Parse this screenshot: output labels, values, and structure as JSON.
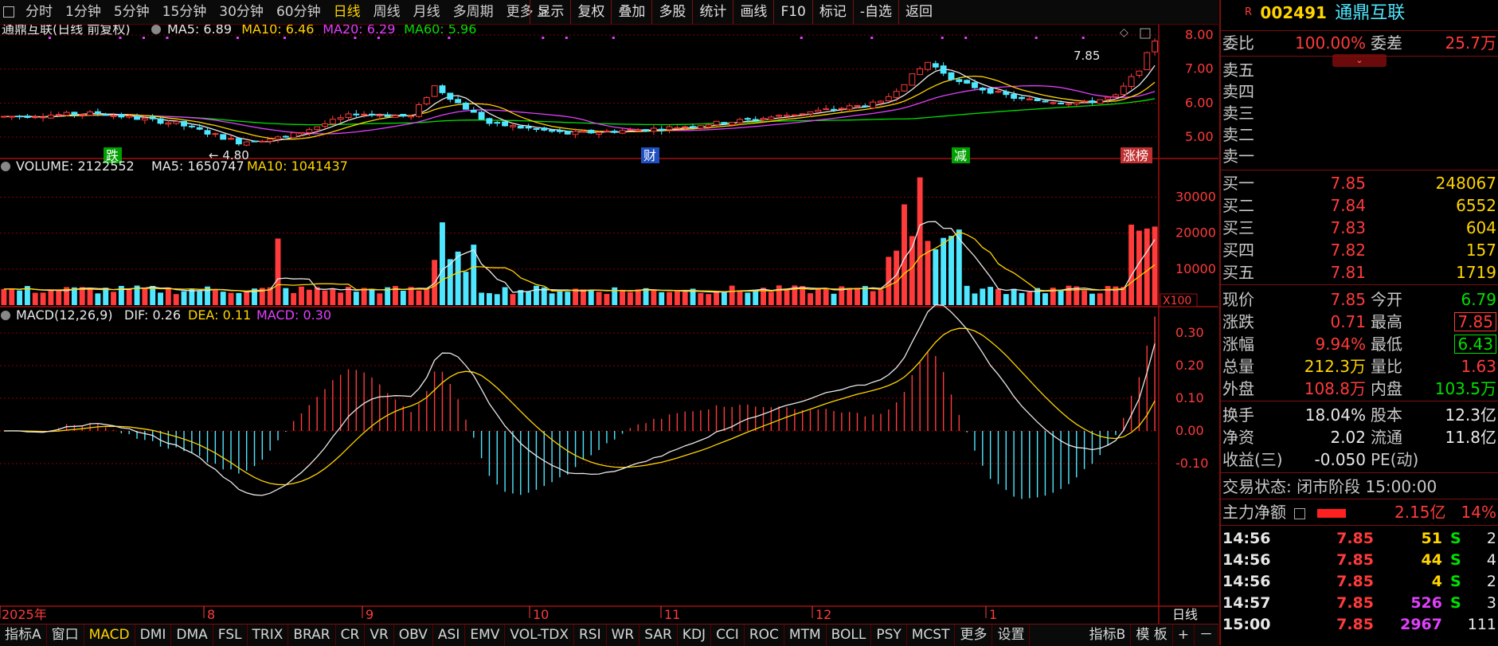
{
  "toolbar": {
    "periods": [
      "分时",
      "1分钟",
      "5分钟",
      "15分钟",
      "30分钟",
      "60分钟",
      "日线",
      "周线",
      "月线",
      "多周期",
      "更多 >"
    ],
    "active_period": "日线",
    "right_buttons": [
      "显示",
      "复权",
      "叠加",
      "多股",
      "统计",
      "画线",
      "F10",
      "标记",
      "-自选",
      "返回"
    ]
  },
  "main_chart": {
    "title": "通鼎互联(日线 前复权)",
    "ma_labels": [
      {
        "text": "MA5: 6.89",
        "color": "#e8e8e8"
      },
      {
        "text": "MA10: 6.46",
        "color": "#ffd400"
      },
      {
        "text": "MA20: 6.29",
        "color": "#e040fb"
      },
      {
        "text": "MA60: 5.96",
        "color": "#00e000"
      }
    ],
    "price_axis": [
      "8.00",
      "7.00",
      "6.00",
      "5.00"
    ],
    "high_label": "7.85",
    "low_label": "4.80",
    "markers": [
      {
        "text": "跌",
        "bg": "#00a000"
      },
      {
        "text": "财",
        "bg": "#2050c0"
      },
      {
        "text": "减",
        "bg": "#00a000"
      },
      {
        "text": "涨榜",
        "bg": "#c03030"
      }
    ]
  },
  "volume_chart": {
    "title": "VOLUME: 2122552",
    "ma5": "MA5: 1650747",
    "ma10": "MA10: 1041437",
    "axis": [
      "30000",
      "20000",
      "10000"
    ],
    "unit": "X100"
  },
  "macd_chart": {
    "title": "MACD(12,26,9)",
    "dif": "DIF: 0.26",
    "dea": "DEA: 0.11",
    "macd": "MACD: 0.30",
    "axis": [
      "0.30",
      "0.20",
      "0.10",
      "0.00",
      "-0.10"
    ]
  },
  "time_axis": {
    "labels": [
      "2025年",
      "8",
      "9",
      "10",
      "11",
      "12",
      "1"
    ],
    "period_label": "日线"
  },
  "bottom_tabs": {
    "left": [
      "指标A",
      "窗口",
      "MACD",
      "DMI",
      "DMA",
      "FSL",
      "TRIX",
      "BRAR",
      "CR",
      "VR",
      "OBV",
      "ASI",
      "EMV",
      "VOL-TDX",
      "RSI",
      "WR",
      "SAR",
      "KDJ",
      "CCI",
      "ROC",
      "MTM",
      "BOLL",
      "PSY",
      "MCST",
      "更多",
      "设置"
    ],
    "active": "MACD",
    "right": [
      "指标B",
      "模 板",
      "+",
      "－"
    ]
  },
  "quote": {
    "code": "002491",
    "name": "通鼎互联",
    "r_mark": "R",
    "weibi_label": "委比",
    "weibi": "100.00%",
    "weicha_label": "委差",
    "weicha": "25.7万",
    "sells": [
      "卖五",
      "卖四",
      "卖三",
      "卖二",
      "卖一"
    ],
    "buys": [
      {
        "label": "买一",
        "price": "7.85",
        "vol": "248067"
      },
      {
        "label": "买二",
        "price": "7.84",
        "vol": "6552"
      },
      {
        "label": "买三",
        "price": "7.83",
        "vol": "604"
      },
      {
        "label": "买四",
        "price": "7.82",
        "vol": "157"
      },
      {
        "label": "买五",
        "price": "7.81",
        "vol": "1719"
      }
    ],
    "stats": [
      {
        "l": "现价",
        "v": "7.85",
        "vc": "red",
        "l2": "今开",
        "v2": "6.79",
        "v2c": "green"
      },
      {
        "l": "涨跌",
        "v": "0.71",
        "vc": "red",
        "l2": "最高",
        "v2": "7.85",
        "v2c": "red"
      },
      {
        "l": "涨幅",
        "v": "9.94%",
        "vc": "red",
        "l2": "最低",
        "v2": "6.43",
        "v2c": "green"
      },
      {
        "l": "总量",
        "v": "212.3万",
        "vc": "yellow",
        "l2": "量比",
        "v2": "1.63",
        "v2c": "red"
      },
      {
        "l": "外盘",
        "v": "108.8万",
        "vc": "red",
        "l2": "内盘",
        "v2": "103.5万",
        "v2c": "green"
      }
    ],
    "stats2": [
      {
        "l": "换手",
        "v": "18.04%",
        "l2": "股本",
        "v2": "12.3亿"
      },
      {
        "l": "净资",
        "v": "2.02",
        "l2": "流通",
        "v2": "11.8亿"
      },
      {
        "l": "收益(三)",
        "v": "-0.050",
        "l2": "PE(动)",
        "v2": ""
      }
    ],
    "trade_status": "交易状态: 闭市阶段 15:00:00",
    "main_flow_label": "主力净额",
    "main_flow_value": "2.15亿",
    "main_flow_pct": "14%",
    "ticks": [
      {
        "t": "14:56",
        "p": "7.85",
        "v": "51",
        "vc": "yellow",
        "s": "S",
        "n": "2"
      },
      {
        "t": "14:56",
        "p": "7.85",
        "v": "44",
        "vc": "yellow",
        "s": "S",
        "n": "4"
      },
      {
        "t": "14:56",
        "p": "7.85",
        "v": "4",
        "vc": "yellow",
        "s": "S",
        "n": "2"
      },
      {
        "t": "14:57",
        "p": "7.85",
        "v": "526",
        "vc": "mag",
        "s": "S",
        "n": "3"
      },
      {
        "t": "15:00",
        "p": "7.85",
        "v": "2967",
        "vc": "mag",
        "s": "",
        "n": "111"
      }
    ]
  },
  "colors": {
    "up": "#ff3b3b",
    "down": "#4fe7ff",
    "grid": "#8a0000",
    "ma5": "#e8e8e8",
    "ma10": "#ffd400",
    "ma20": "#e040fb",
    "ma60": "#00e000"
  }
}
